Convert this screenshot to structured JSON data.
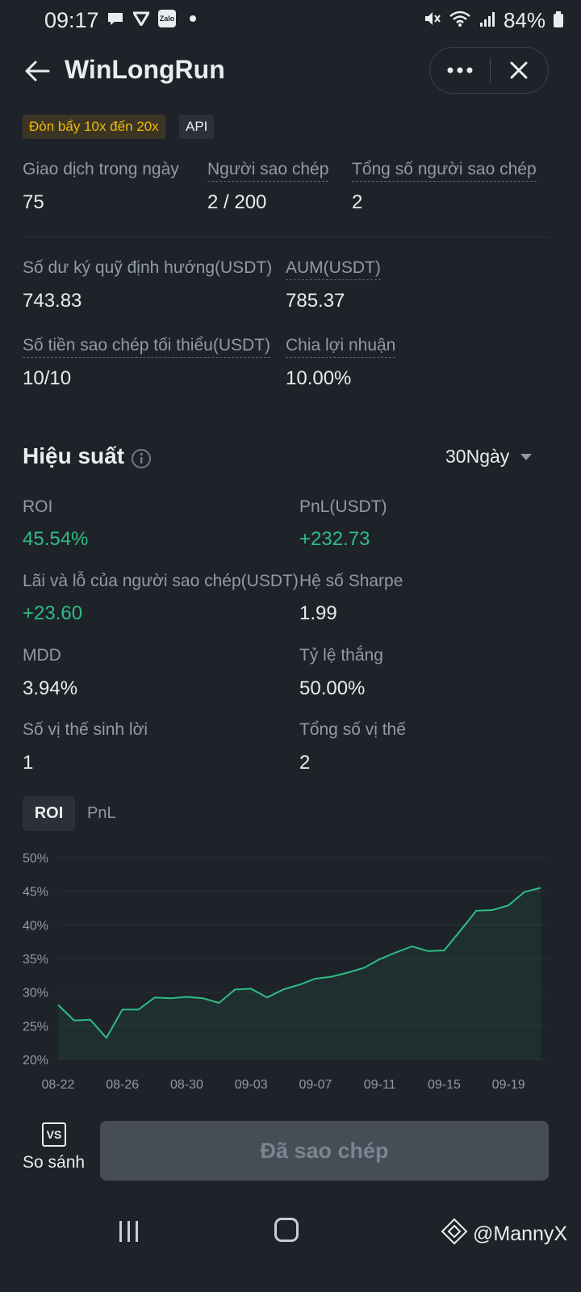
{
  "status_bar": {
    "time": "09:17",
    "zalo": "Zalo",
    "battery": "84%"
  },
  "header": {
    "title": "WinLongRun"
  },
  "tags": {
    "leverage": "Đòn bẩy 10x đến 20x",
    "api": "API"
  },
  "stats_top": [
    {
      "label": "Giao dịch trong ngày",
      "value": "75"
    },
    {
      "label": "Người sao chép",
      "value": "2 / 200"
    },
    {
      "label": "Tổng số người sao chép",
      "value": "2"
    }
  ],
  "stats_funds": [
    {
      "label": "Số dư ký quỹ định hướng(USDT)",
      "value": "743.83"
    },
    {
      "label": "AUM(USDT)",
      "value": "785.37"
    },
    {
      "label": "Số tiền sao chép tối thiểu(USDT)",
      "value": "10/10"
    },
    {
      "label": "Chia lợi nhuận",
      "value": "10.00%"
    }
  ],
  "performance": {
    "title": "Hiệu suất",
    "period": "30Ngày",
    "metrics": [
      {
        "label": "ROI",
        "value": "45.54%"
      },
      {
        "label": "PnL(USDT)",
        "value": "+232.73"
      },
      {
        "label": "Lãi và lỗ của người sao chép(USDT)",
        "value": "+23.60"
      },
      {
        "label": "Hệ số Sharpe",
        "value": "1.99"
      },
      {
        "label": "MDD",
        "value": "3.94%"
      },
      {
        "label": "Tỷ lệ thắng",
        "value": "50.00%"
      },
      {
        "label": "Số vị thế sinh lời",
        "value": "1"
      },
      {
        "label": "Tổng số vị thế",
        "value": "2"
      }
    ],
    "tabs": {
      "roi": "ROI",
      "pnl": "PnL"
    }
  },
  "chart_data": {
    "type": "area",
    "ylim": [
      20,
      50
    ],
    "y_ticks": [
      "20%",
      "25%",
      "30%",
      "35%",
      "40%",
      "45%",
      "50%"
    ],
    "x_ticks": [
      "08-22",
      "08-26",
      "08-30",
      "09-03",
      "09-07",
      "09-11",
      "09-15",
      "09-19"
    ],
    "x": [
      "08-22",
      "08-23",
      "08-24",
      "08-25",
      "08-26",
      "08-27",
      "08-28",
      "08-29",
      "08-30",
      "08-31",
      "09-01",
      "09-02",
      "09-03",
      "09-04",
      "09-05",
      "09-06",
      "09-07",
      "09-08",
      "09-09",
      "09-10",
      "09-11",
      "09-12",
      "09-13",
      "09-14",
      "09-15",
      "09-16",
      "09-17",
      "09-18",
      "09-19",
      "09-20",
      "09-21"
    ],
    "series": [
      {
        "values": [
          28.1,
          25.8,
          25.9,
          23.2,
          27.4,
          27.4,
          29.2,
          29.1,
          29.3,
          29.1,
          28.4,
          30.4,
          30.5,
          29.2,
          30.4,
          31.1,
          32.0,
          32.3,
          32.9,
          33.6,
          34.9,
          35.9,
          36.8,
          36.1,
          36.2,
          39.1,
          42.1,
          42.2,
          42.9,
          44.9,
          45.5
        ]
      }
    ],
    "line_color": "#2ebd85",
    "grid": true
  },
  "bottom": {
    "compare_icon": "VS",
    "compare_label": "So sánh",
    "copied_label": "Đã sao chép"
  },
  "watermark": "@MannyX"
}
